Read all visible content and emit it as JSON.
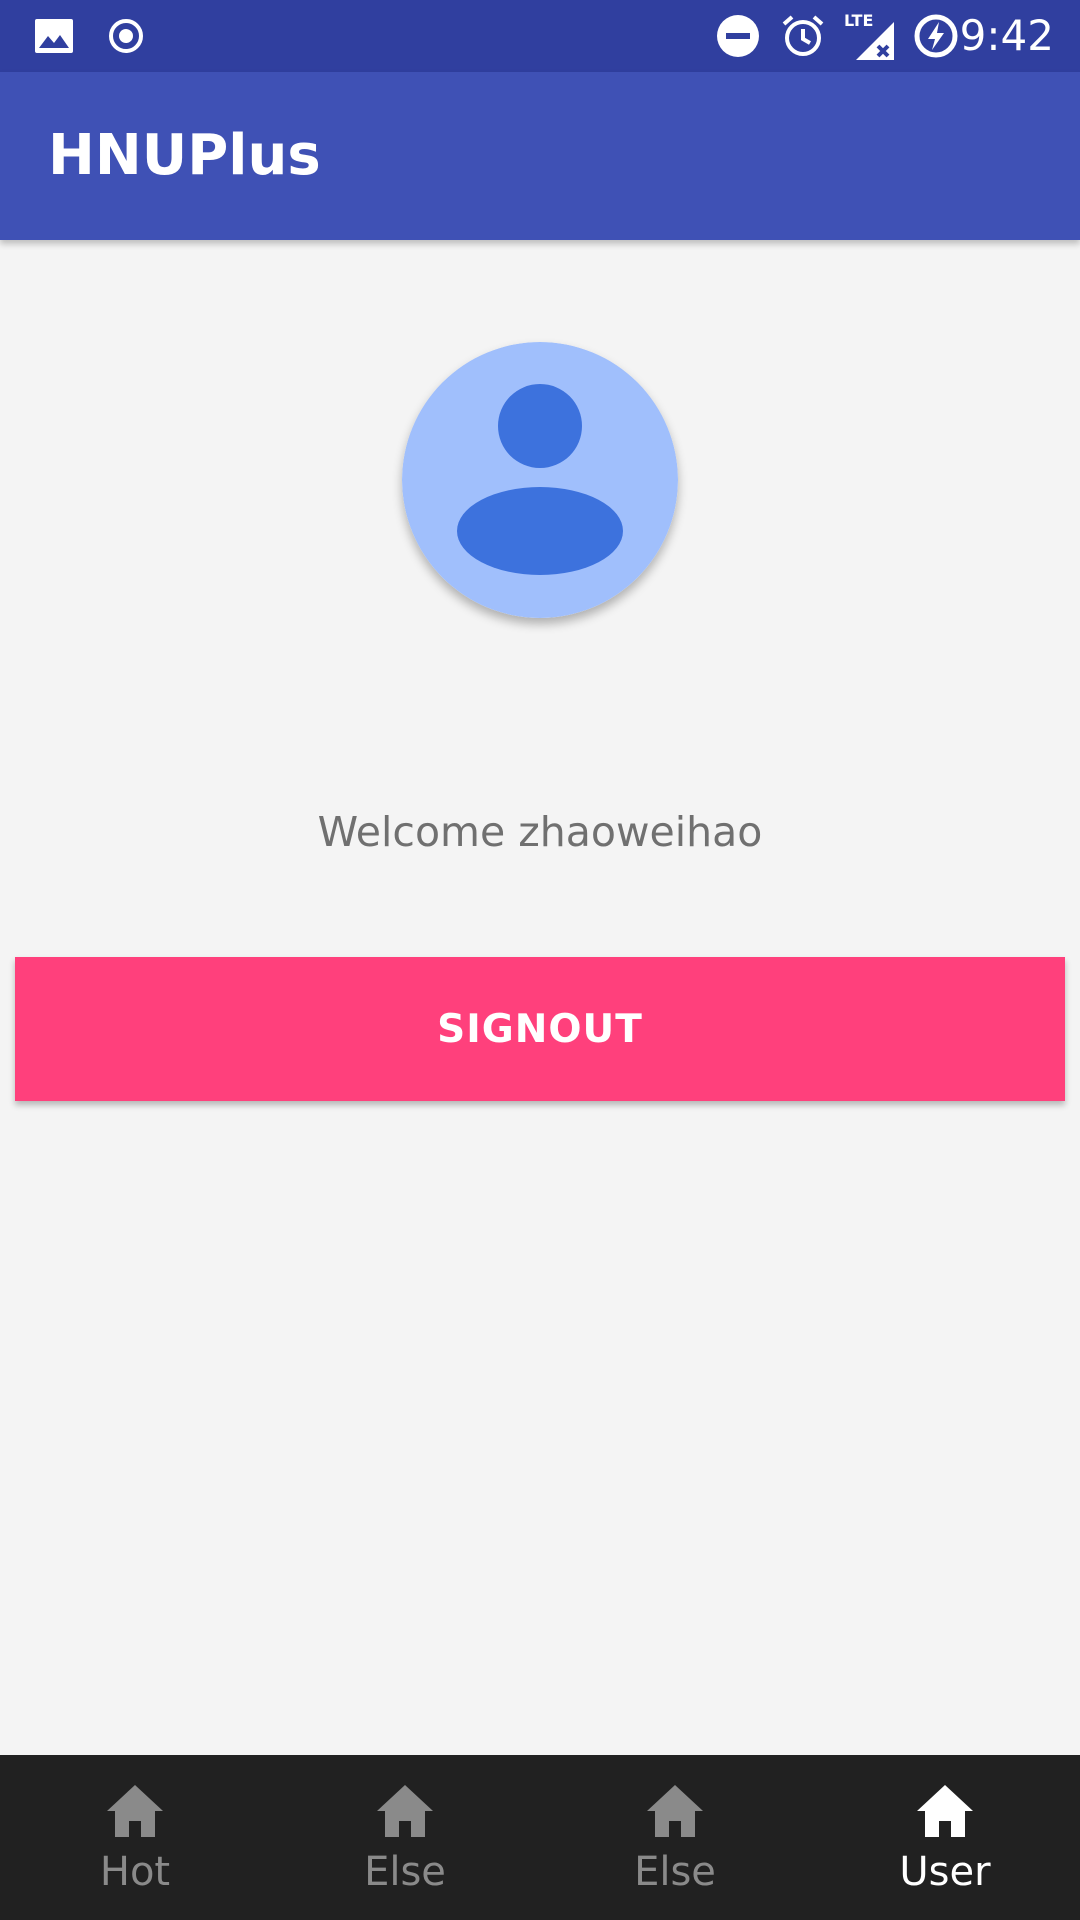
{
  "status_bar": {
    "time": "9:42",
    "left_icons": [
      "image-icon",
      "record-icon"
    ],
    "right_icons": [
      "do-not-disturb-icon",
      "alarm-icon",
      "lte-signal-icon",
      "battery-charging-icon"
    ],
    "network_label": "LTE"
  },
  "app_bar": {
    "title": "HNUPlus"
  },
  "profile": {
    "avatar_icon": "person-avatar-icon",
    "welcome": "Welcome zhaoweihao"
  },
  "actions": {
    "signout_label": "SIGNOUT"
  },
  "bottom_nav": {
    "items": [
      {
        "label": "Hot",
        "icon": "home-icon",
        "active": false
      },
      {
        "label": "Else",
        "icon": "home-icon",
        "active": false
      },
      {
        "label": "Else",
        "icon": "home-icon",
        "active": false
      },
      {
        "label": "User",
        "icon": "home-icon",
        "active": true
      }
    ]
  },
  "colors": {
    "status_bar": "#303f9f",
    "app_bar": "#3f51b5",
    "background": "#f4f4f4",
    "accent_button": "#ff407c",
    "bottom_nav": "#212121",
    "nav_inactive": "#8a8a8a",
    "nav_active": "#ffffff",
    "avatar_bg": "#a0bffc",
    "avatar_figure": "#3d72dd"
  }
}
